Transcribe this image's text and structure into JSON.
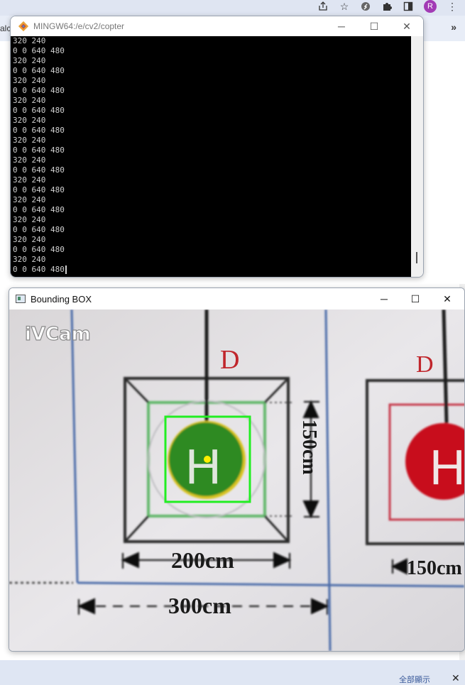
{
  "browser": {
    "tab_fragment": "alc",
    "overflow": "»",
    "profile_initial": "R",
    "bottom_text": "全部顯示",
    "bottom_close": "✕"
  },
  "terminal": {
    "title": "MINGW64:/e/cv2/copter",
    "lines": [
      "320 240",
      "0 0 640 480",
      "320 240",
      "0 0 640 480",
      "320 240",
      "0 0 640 480",
      "320 240",
      "0 0 640 480",
      "320 240",
      "0 0 640 480",
      "320 240",
      "0 0 640 480",
      "320 240",
      "0 0 640 480",
      "320 240",
      "0 0 640 480",
      "320 240",
      "0 0 640 480",
      "320 240",
      "0 0 640 480",
      "320 240",
      "0 0 640 480",
      "320 240",
      "0 0 640 480"
    ]
  },
  "viewer": {
    "title": "Bounding BOX",
    "watermark": "iVCam",
    "label_d_left": "D",
    "label_d_right": "D",
    "pad_letter": "H",
    "dim_vertical": "150cm",
    "dim_horizontal": "200cm",
    "dim_total": "300cm",
    "dim_right": "150cm",
    "colors": {
      "box": "#22ee22",
      "center_dot": "#ffee00",
      "pad_green": "#2e8a22",
      "pad_red": "#c8101c",
      "label_d": "#c0262c"
    }
  }
}
